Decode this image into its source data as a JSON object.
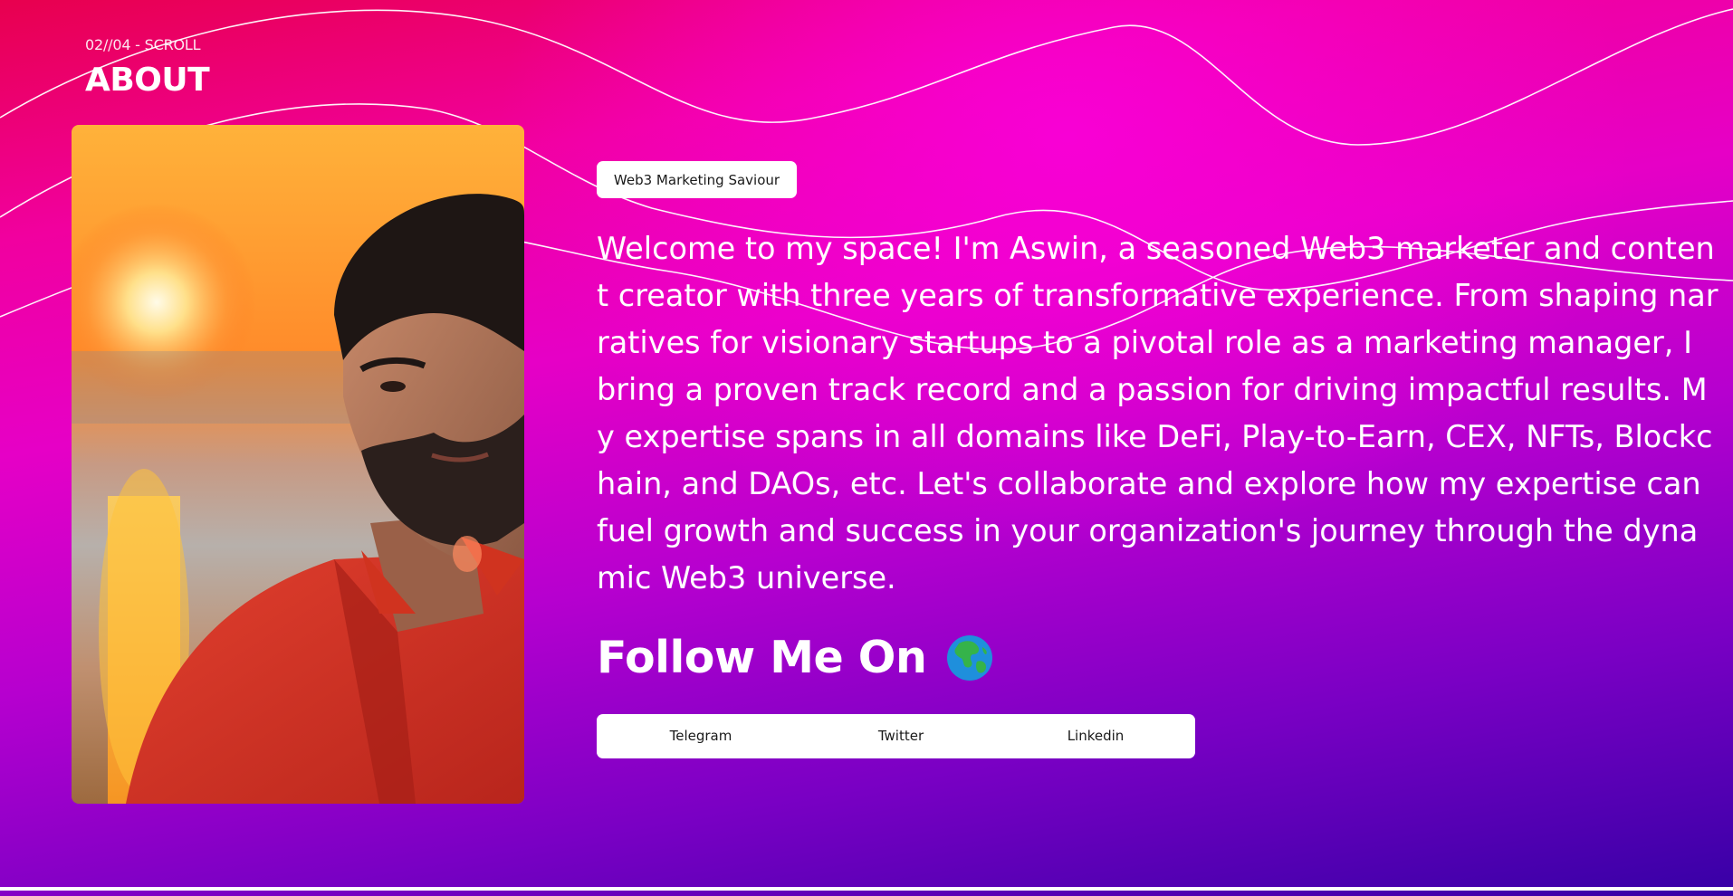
{
  "header": {
    "scroll_indicator": "02//04 - SCROLL",
    "title": "ABOUT"
  },
  "profile": {
    "photo_alt": "Portrait of Aswin at sunset wearing a red shirt",
    "role_badge": "Web3 Marketing Saviour",
    "bio": "Welcome to my space! I'm Aswin, a seasoned Web3 marketer and content creator with three years of transformative experience. From shaping narratives for visionary startups to a pivotal role as a marketing manager, I bring a proven track record and a passion for driving impactful results. My expertise spans in all domains like DeFi, Play-to-Earn, CEX, NFTs, Blockchain, and DAOs, etc. Let's collaborate and explore how my expertise can fuel growth and success in your organization's journey through the dynamic Web3 universe."
  },
  "follow": {
    "heading": "Follow Me On",
    "icon": "globe-asia-icon",
    "links": [
      {
        "label": "Telegram"
      },
      {
        "label": "Twitter"
      },
      {
        "label": "Linkedin"
      }
    ]
  },
  "theme": {
    "gradient_top": "#e8004e",
    "gradient_mid": "#f000c8",
    "gradient_bottom": "#3700a6",
    "text": "#ffffff",
    "button_bg": "#ffffff",
    "button_text": "#1a1a1a"
  }
}
